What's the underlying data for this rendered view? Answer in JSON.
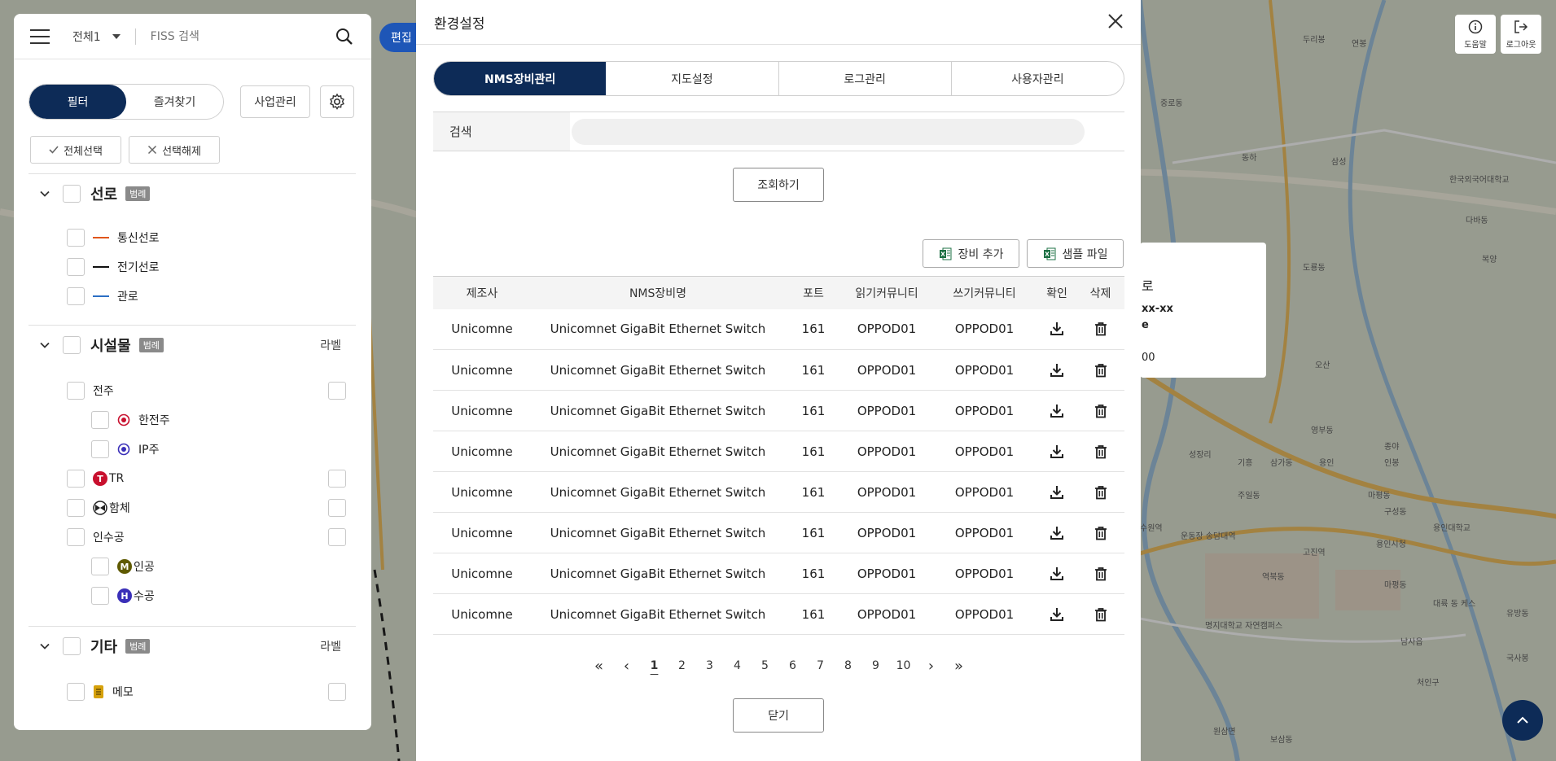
{
  "map": {
    "place_labels": [
      "선로",
      "연봉",
      "중로동",
      "동하",
      "삼성",
      "도룡동",
      "고성읍",
      "복양",
      "오산",
      "영부동",
      "용인",
      "기흥",
      "종야",
      "성장리",
      "인봉",
      "마평동",
      "구성동",
      "수원역",
      "한국외국어대학교",
      "다바동",
      "삼가동",
      "용인대학교",
      "주일동",
      "운동장 송담대역",
      "역북동",
      "고진역",
      "용인시청",
      "처인구",
      "국사봉",
      "보삼동",
      "원삼면",
      "남사읍",
      "명지대학교 자연캠퍼스",
      "대륙 동 케스",
      "마평동",
      "유방동",
      "두리봉"
    ],
    "popup_partial": [
      "로",
      "xx-xx",
      "e",
      "00"
    ]
  },
  "left_panel": {
    "search": {
      "scope": "전체1",
      "placeholder": "FISS 검색"
    },
    "tabs": [
      {
        "label": "필터"
      },
      {
        "label": "즐겨찾기"
      }
    ],
    "business_button": "사업관리",
    "select_all": "전체선택",
    "deselect": "선택해제",
    "sections": {
      "lines": {
        "title": "선로",
        "tag": "범례",
        "items": [
          {
            "label": "통신선로",
            "color": "#e0561b"
          },
          {
            "label": "전기선로",
            "color": "#111111"
          },
          {
            "label": "관로",
            "color": "#2b6fc4"
          }
        ]
      },
      "facilities": {
        "title": "시설물",
        "tag": "범례",
        "label_col": "라벨",
        "pole": "전주",
        "pole_children": [
          "한전주",
          "IP주"
        ],
        "tr": {
          "badge": "T",
          "label": "TR",
          "color": "#c8102e"
        },
        "hamche": "함체",
        "insugong": "인수공",
        "insugong_children": [
          {
            "badge": "M",
            "label": "인공",
            "color": "#5f5a00"
          },
          {
            "badge": "H",
            "label": "수공",
            "color": "#3a2fb8"
          }
        ]
      },
      "etc": {
        "title": "기타",
        "tag": "범례",
        "label_col": "라벨",
        "memo": "메모"
      }
    }
  },
  "map_controls": {
    "edit_label": "편집 C",
    "help_label": "도움말",
    "logout_label": "로그아웃"
  },
  "modal": {
    "title": "환경설정",
    "tabs": [
      {
        "label": "NMS장비관리"
      },
      {
        "label": "지도설정"
      },
      {
        "label": "로그관리"
      },
      {
        "label": "사용자관리"
      }
    ],
    "search_label": "검색",
    "search_value": "",
    "query_button": "조회하기",
    "add_device_button": "장비 추가",
    "sample_file_button": "샘플 파일",
    "table": {
      "headers": [
        "제조사",
        "NMS장비명",
        "포트",
        "읽기커뮤니티",
        "쓰기커뮤니티",
        "확인",
        "삭제"
      ],
      "rows": [
        {
          "vendor": "Unicomne",
          "name": "Unicomnet GigaBit Ethernet Switch",
          "port": "161",
          "read": "OPPOD01",
          "write": "OPPOD01"
        },
        {
          "vendor": "Unicomne",
          "name": "Unicomnet GigaBit Ethernet Switch",
          "port": "161",
          "read": "OPPOD01",
          "write": "OPPOD01"
        },
        {
          "vendor": "Unicomne",
          "name": "Unicomnet GigaBit Ethernet Switch",
          "port": "161",
          "read": "OPPOD01",
          "write": "OPPOD01"
        },
        {
          "vendor": "Unicomne",
          "name": "Unicomnet GigaBit Ethernet Switch",
          "port": "161",
          "read": "OPPOD01",
          "write": "OPPOD01"
        },
        {
          "vendor": "Unicomne",
          "name": "Unicomnet GigaBit Ethernet Switch",
          "port": "161",
          "read": "OPPOD01",
          "write": "OPPOD01"
        },
        {
          "vendor": "Unicomne",
          "name": "Unicomnet GigaBit Ethernet Switch",
          "port": "161",
          "read": "OPPOD01",
          "write": "OPPOD01"
        },
        {
          "vendor": "Unicomne",
          "name": "Unicomnet GigaBit Ethernet Switch",
          "port": "161",
          "read": "OPPOD01",
          "write": "OPPOD01"
        },
        {
          "vendor": "Unicomne",
          "name": "Unicomnet GigaBit Ethernet Switch",
          "port": "161",
          "read": "OPPOD01",
          "write": "OPPOD01"
        }
      ]
    },
    "pagination": {
      "pages": [
        "1",
        "2",
        "3",
        "4",
        "5",
        "6",
        "7",
        "8",
        "9",
        "10"
      ],
      "current": "1",
      "first": "«",
      "prev": "‹",
      "next": "›",
      "last": "»"
    },
    "close_button": "닫기"
  }
}
